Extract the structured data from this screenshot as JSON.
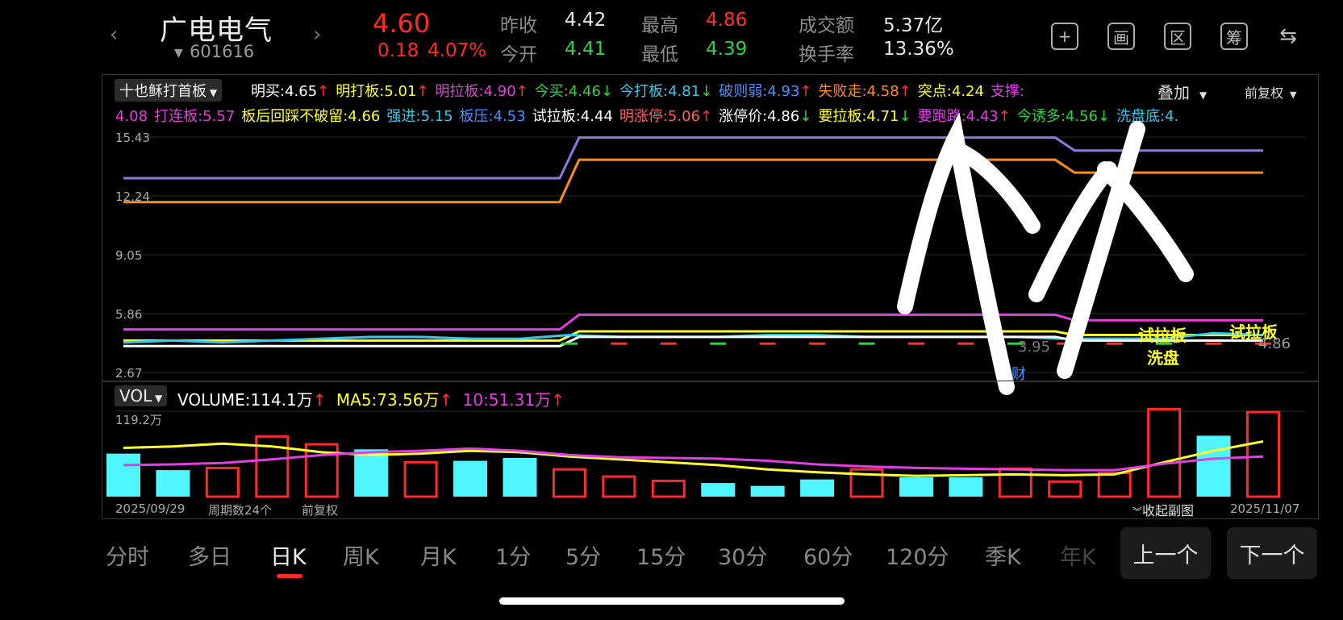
{
  "header": {
    "prev_arrow": "‹",
    "next_arrow": "›",
    "stock_name": "广电电气",
    "stock_code": "601616",
    "price": "4.60",
    "change": "0.18",
    "change_pct": "4.07%",
    "quotes": [
      {
        "label": "昨收",
        "value": "4.42",
        "color": "#e6e6e6"
      },
      {
        "label": "今开",
        "value": "4.41",
        "color": "#2fd147"
      },
      {
        "label": "最高",
        "value": "4.86",
        "color": "#ff3131"
      },
      {
        "label": "最低",
        "value": "4.39",
        "color": "#2fd147"
      },
      {
        "label": "成交额",
        "value": "5.37亿",
        "color": "#e6e6e6"
      },
      {
        "label": "换手率",
        "value": "13.36%",
        "color": "#e6e6e6"
      }
    ],
    "icons": [
      "plus-icon",
      "draw-icon",
      "zone-icon",
      "chip-icon",
      "switch-device-icon"
    ],
    "icon_glyphs": [
      "+",
      "画",
      "区",
      "筹",
      "⇆"
    ]
  },
  "main_chart": {
    "indicator_select": "十也稣打首板",
    "overlay_select": "叠加",
    "adjust_select": "前复权",
    "indicators_row1": [
      {
        "text": "明买:4.65",
        "color": "#ffffff",
        "arrow": "↑"
      },
      {
        "text": "明打板:5.01",
        "color": "#ffff30",
        "arrow": "↑"
      },
      {
        "text": "明拉板:4.90",
        "color": "#e040e0",
        "arrow": "↑"
      },
      {
        "text": "今买:4.46",
        "color": "#2fd147",
        "arrow": "↓"
      },
      {
        "text": "今打板:4.81",
        "color": "#38c8e8",
        "arrow": "↓"
      },
      {
        "text": "破则弱:4.93",
        "color": "#4a90ff",
        "arrow": "↑"
      },
      {
        "text": "失败走:4.58",
        "color": "#ff8c1a",
        "arrow": "↑"
      },
      {
        "text": "突点:4.24",
        "color": "#ffff30",
        "arrow": ""
      },
      {
        "text": "支撑:",
        "color": "#e040e0",
        "arrow": ""
      }
    ],
    "indicators_row2": [
      {
        "text": "4.08",
        "color": "#e040e0",
        "arrow": ""
      },
      {
        "text": "打连板:5.57",
        "color": "#e040e0",
        "arrow": ""
      },
      {
        "text": "板后回踩不破留:4.66",
        "color": "#ffff30",
        "arrow": ""
      },
      {
        "text": "强进:5.15",
        "color": "#38c8e8",
        "arrow": ""
      },
      {
        "text": "板压:4.53",
        "color": "#4a90ff",
        "arrow": ""
      },
      {
        "text": "试拉板:4.44",
        "color": "#ffffff",
        "arrow": ""
      },
      {
        "text": "明涨停:5.06",
        "color": "#ff6060",
        "arrow": "↑"
      },
      {
        "text": "涨停价:4.86",
        "color": "#ffffff",
        "arrow": "↓"
      },
      {
        "text": "要拉板:4.71",
        "color": "#ffff30",
        "arrow": "↓"
      },
      {
        "text": "要跑路:4.43",
        "color": "#e040e0",
        "arrow": "↑"
      },
      {
        "text": "今诱多:4.56",
        "color": "#2fd147",
        "arrow": "↓"
      },
      {
        "text": "洗盘底:4.",
        "color": "#38c8e8",
        "arrow": ""
      }
    ],
    "y_ticks": [
      "15.43",
      "12.24",
      "9.05",
      "5.86",
      "2.67"
    ],
    "markers": [
      {
        "text": "试拉板",
        "color": "#ffff30"
      },
      {
        "text": "洗盘",
        "color": "#ffff30"
      },
      {
        "text": "试拉板",
        "color": "#ffff30"
      },
      {
        "text": "3.95",
        "color": "#777777"
      },
      {
        "text": "4.86",
        "color": "#999999"
      },
      {
        "text": "财",
        "color": "#4a90ff"
      }
    ]
  },
  "chart_data": {
    "type": "line",
    "x": [
      "1",
      "2",
      "3",
      "4",
      "5",
      "6",
      "7",
      "8",
      "9",
      "10",
      "11",
      "12",
      "13",
      "14",
      "15",
      "16",
      "17",
      "18",
      "19",
      "20",
      "21",
      "22",
      "23",
      "24"
    ],
    "series": [
      {
        "color": "#8a7bdc",
        "values": [
          13.2,
          13.2,
          13.2,
          13.2,
          13.2,
          13.2,
          13.2,
          13.2,
          13.2,
          15.4,
          15.4,
          15.4,
          15.4,
          15.4,
          15.4,
          15.4,
          15.4,
          15.4,
          15.4,
          14.7,
          14.7,
          14.7,
          14.7,
          14.7
        ]
      },
      {
        "color": "#ff8c1a",
        "values": [
          11.9,
          11.9,
          11.9,
          11.9,
          11.9,
          11.9,
          11.9,
          11.9,
          11.9,
          14.2,
          14.2,
          14.2,
          14.2,
          14.2,
          14.2,
          14.2,
          14.2,
          14.2,
          14.2,
          13.5,
          13.5,
          13.5,
          13.5,
          13.5
        ]
      },
      {
        "color": "#e040e0",
        "values": [
          5.0,
          5.0,
          5.0,
          5.0,
          5.0,
          5.0,
          5.0,
          5.0,
          5.0,
          5.8,
          5.8,
          5.8,
          5.8,
          5.8,
          5.8,
          5.8,
          5.8,
          5.8,
          5.8,
          5.5,
          5.5,
          5.5,
          5.5,
          5.5
        ]
      },
      {
        "color": "#ffff30",
        "values": [
          4.4,
          4.4,
          4.4,
          4.4,
          4.4,
          4.4,
          4.4,
          4.4,
          4.4,
          4.9,
          4.9,
          4.9,
          4.9,
          4.9,
          4.9,
          4.9,
          4.9,
          4.9,
          4.9,
          4.7,
          4.7,
          4.7,
          4.7,
          4.7
        ]
      },
      {
        "color": "#38c8e8",
        "values": [
          4.3,
          4.4,
          4.3,
          4.4,
          4.5,
          4.6,
          4.6,
          4.5,
          4.5,
          4.7,
          4.6,
          4.6,
          4.6,
          4.7,
          4.7,
          4.6,
          4.6,
          4.6,
          4.6,
          4.5,
          4.5,
          4.5,
          4.8,
          4.7
        ]
      },
      {
        "color": "#ffffff",
        "values": [
          4.1,
          4.1,
          4.1,
          4.1,
          4.1,
          4.1,
          4.1,
          4.1,
          4.1,
          4.6,
          4.6,
          4.6,
          4.6,
          4.6,
          4.6,
          4.6,
          4.6,
          4.6,
          4.6,
          4.4,
          4.4,
          4.4,
          4.4,
          4.4
        ]
      }
    ],
    "y_range": [
      2.67,
      15.43
    ],
    "grid": true
  },
  "volume_chart": {
    "indicator_select": "VOL",
    "volume_label": "VOLUME:114.1万",
    "volume_arrow": "↑",
    "ma5_label": "MA5:73.56万",
    "ma5_arrow": "↑",
    "ma10_label": "10:51.31万",
    "ma10_arrow": "↑",
    "y_max_label": "119.2万",
    "date_start": "2025/09/29",
    "period_count": "周期数24个",
    "adjust": "前复权",
    "collapse": "收起副图",
    "date_end": "2025/11/07",
    "max": 119.2,
    "bars": [
      {
        "v": 60,
        "up": false
      },
      {
        "v": 37,
        "up": false
      },
      {
        "v": 40,
        "up": true
      },
      {
        "v": 84,
        "up": true
      },
      {
        "v": 73,
        "up": true
      },
      {
        "v": 66,
        "up": false
      },
      {
        "v": 48,
        "up": true
      },
      {
        "v": 50,
        "up": false
      },
      {
        "v": 54,
        "up": false
      },
      {
        "v": 38,
        "up": true
      },
      {
        "v": 28,
        "up": true
      },
      {
        "v": 22,
        "up": true
      },
      {
        "v": 19,
        "up": false
      },
      {
        "v": 15,
        "up": false
      },
      {
        "v": 24,
        "up": false
      },
      {
        "v": 38,
        "up": true
      },
      {
        "v": 27,
        "up": false
      },
      {
        "v": 27,
        "up": false
      },
      {
        "v": 39,
        "up": true
      },
      {
        "v": 21,
        "up": true
      },
      {
        "v": 33,
        "up": true
      },
      {
        "v": 122,
        "up": true
      },
      {
        "v": 85,
        "up": false
      },
      {
        "v": 118,
        "up": true
      }
    ],
    "ma5": [
      68,
      70,
      74,
      70,
      62,
      58,
      60,
      64,
      62,
      56,
      52,
      48,
      44,
      38,
      34,
      31,
      29,
      30,
      31,
      30,
      31,
      48,
      64,
      77
    ],
    "ma10": [
      44,
      45,
      47,
      52,
      58,
      62,
      64,
      67,
      64,
      58,
      55,
      54,
      53,
      50,
      45,
      42,
      40,
      39,
      38,
      37,
      37,
      46,
      53,
      56
    ]
  },
  "tabs": [
    "分时",
    "多日",
    "日K",
    "周K",
    "月K",
    "1分",
    "5分",
    "15分",
    "30分",
    "60分",
    "120分",
    "季K",
    "年K"
  ],
  "active_tab": 2,
  "buttons": {
    "prev": "上一个",
    "next": "下一个"
  }
}
